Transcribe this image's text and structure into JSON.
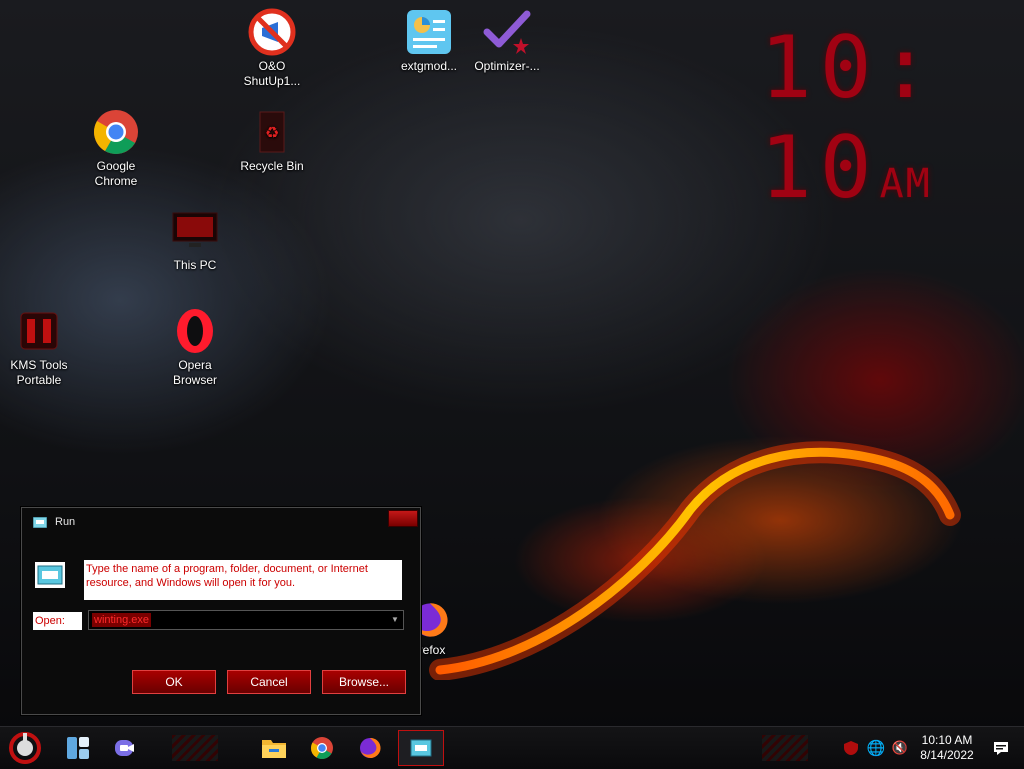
{
  "desktop": {
    "icons": [
      {
        "name": "O&O\nShutUp1...",
        "line1": "O&O",
        "line2": "ShutUp1..."
      },
      {
        "name": "extgmod...",
        "line1": "extgmod...",
        "line2": ""
      },
      {
        "name": "Optimizer-...",
        "line1": "Optimizer-...",
        "line2": ""
      },
      {
        "line1": "Google",
        "line2": "Chrome"
      },
      {
        "line1": "Recycle Bin",
        "line2": ""
      },
      {
        "line1": "This PC",
        "line2": ""
      },
      {
        "line1": "KMS Tools",
        "line2": "Portable"
      },
      {
        "line1": "Opera",
        "line2": "Browser"
      },
      {
        "line1": "refox",
        "line2": ""
      }
    ],
    "clock": {
      "time": "10: 10",
      "ampm": "AM"
    }
  },
  "run_dialog": {
    "title": "Run",
    "description": "Type the name of a program, folder, document, or Internet resource, and Windows will open it for you.",
    "open_label": "Open:",
    "open_value": "winting.exe",
    "ok_label": "OK",
    "cancel_label": "Cancel",
    "browse_label": "Browse..."
  },
  "taskbar": {
    "time": "10:10 AM",
    "date": "8/14/2022"
  },
  "colors": {
    "accent": "#c00000",
    "desc_text": "#cc0000"
  }
}
